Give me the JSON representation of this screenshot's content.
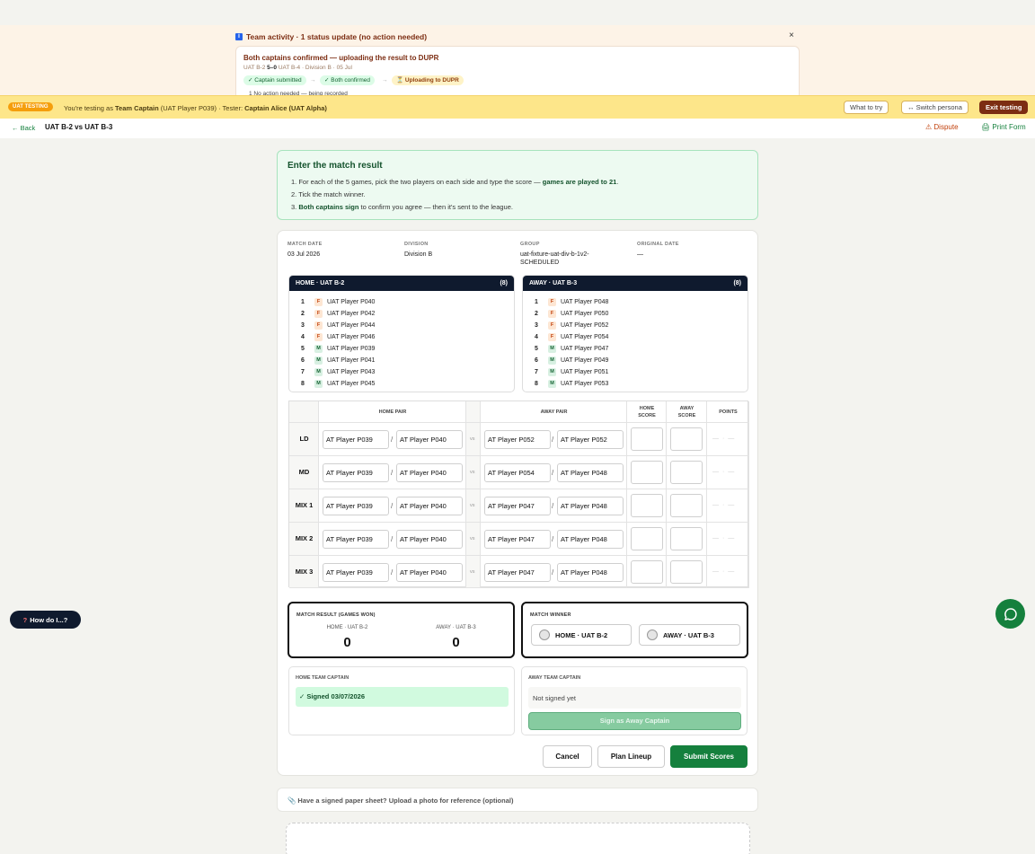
{
  "activity": {
    "header": "Team activity · 1 status update (no action needed)",
    "close": "×",
    "card_title": "Both captains confirmed — uploading the result to DUPR",
    "meta_home": "UAT B-2",
    "meta_score": "5–0",
    "meta_rest": "UAT B-4 · Division B · 05 Jul",
    "chips": [
      "✓ Captain submitted",
      "✓ Both confirmed",
      "⏳ Uploading to DUPR"
    ],
    "arrow": "→",
    "note": "1  No action needed — being recorded"
  },
  "uat": {
    "badge": "UAT TESTING",
    "pre": "You're testing as ",
    "role": "Team Captain",
    "player": " (UAT Player P039)",
    "tester_label": " · Tester: ",
    "tester": "Captain Alice (UAT Alpha)",
    "what": "What to try",
    "switch": "↔ Switch persona",
    "exit": "Exit testing"
  },
  "nav": {
    "back": "← Back",
    "title": "UAT B-2 vs UAT B-3",
    "dispute": "⚠ Dispute",
    "print": "🖨 Print Form"
  },
  "instructions": {
    "title": "Enter the match result",
    "s1_pre": "1. For each of the 5 games, pick the two players on each side and type the score — ",
    "s1_bold": "games are played to 21",
    "s1_post": ".",
    "s2": "2. Tick the match winner.",
    "s3_pre": "3. ",
    "s3_bold": "Both captains sign",
    "s3_post": " to confirm you agree — then it's sent to the league."
  },
  "meta": {
    "date_label": "MATCH DATE",
    "date": "03 Jul 2026",
    "division_label": "DIVISION",
    "division": "Division B",
    "group_label": "GROUP",
    "group": "uat-fixture-uat-div-b-1v2-",
    "group_status": "SCHEDULED",
    "orig_label": "ORIGINAL DATE",
    "orig": "—"
  },
  "home": {
    "title": "HOME · UAT B-2",
    "count": "(8)",
    "players": [
      {
        "n": "1",
        "g": "F",
        "name": "UAT Player P040"
      },
      {
        "n": "2",
        "g": "F",
        "name": "UAT Player P042"
      },
      {
        "n": "3",
        "g": "F",
        "name": "UAT Player P044"
      },
      {
        "n": "4",
        "g": "F",
        "name": "UAT Player P046"
      },
      {
        "n": "5",
        "g": "M",
        "name": "UAT Player P039"
      },
      {
        "n": "6",
        "g": "M",
        "name": "UAT Player P041"
      },
      {
        "n": "7",
        "g": "M",
        "name": "UAT Player P043"
      },
      {
        "n": "8",
        "g": "M",
        "name": "UAT Player P045"
      }
    ]
  },
  "away": {
    "title": "AWAY · UAT B-3",
    "count": "(8)",
    "players": [
      {
        "n": "1",
        "g": "F",
        "name": "UAT Player P048"
      },
      {
        "n": "2",
        "g": "F",
        "name": "UAT Player P050"
      },
      {
        "n": "3",
        "g": "F",
        "name": "UAT Player P052"
      },
      {
        "n": "4",
        "g": "F",
        "name": "UAT Player P054"
      },
      {
        "n": "5",
        "g": "M",
        "name": "UAT Player P047"
      },
      {
        "n": "6",
        "g": "M",
        "name": "UAT Player P049"
      },
      {
        "n": "7",
        "g": "M",
        "name": "UAT Player P051"
      },
      {
        "n": "8",
        "g": "M",
        "name": "UAT Player P053"
      }
    ]
  },
  "games": {
    "hdr_home": "HOME PAIR",
    "hdr_away": "AWAY PAIR",
    "hdr_hs1": "HOME",
    "hdr_hs2": "SCORE",
    "hdr_as1": "AWAY",
    "hdr_as2": "SCORE",
    "hdr_pts": "POINTS",
    "slash": "/",
    "vs": "vs",
    "pts": "— · —",
    "rows": [
      {
        "label": "LD",
        "h1": "AT Player P039",
        "h2": "AT Player P040",
        "a1": "AT Player P052",
        "a2": "AT Player P052"
      },
      {
        "label": "MD",
        "h1": "AT Player P039",
        "h2": "AT Player P040",
        "a1": "AT Player P054",
        "a2": "AT Player P048"
      },
      {
        "label": "MIX 1",
        "h1": "AT Player P039",
        "h2": "AT Player P040",
        "a1": "AT Player P047",
        "a2": "AT Player P048"
      },
      {
        "label": "MIX 2",
        "h1": "AT Player P039",
        "h2": "AT Player P040",
        "a1": "AT Player P047",
        "a2": "AT Player P048"
      },
      {
        "label": "MIX 3",
        "h1": "AT Player P039",
        "h2": "AT Player P040",
        "a1": "AT Player P047",
        "a2": "AT Player P048"
      }
    ]
  },
  "result": {
    "label": "MATCH RESULT (GAMES WON)",
    "home": "HOME · UAT B-2",
    "away": "AWAY · UAT B-3",
    "home_score": "0",
    "away_score": "0"
  },
  "winner": {
    "label": "MATCH WINNER",
    "home": "HOME · UAT B-2",
    "away": "AWAY · UAT B-3"
  },
  "captains": {
    "home_label": "HOME TEAM CAPTAIN",
    "home_status": "✓ Signed 03/07/2026",
    "away_label": "AWAY TEAM CAPTAIN",
    "away_status": "Not signed yet",
    "sign_btn": "Sign as Away Captain"
  },
  "actions": {
    "cancel": "Cancel",
    "plan": "Plan Lineup",
    "submit": "Submit Scores"
  },
  "upload": {
    "text": "📎 Have a signed paper sheet? Upload a photo for reference (optional)"
  },
  "help": {
    "q": "?",
    "label": "How do I...?"
  },
  "colors": {
    "accent": "#15803d",
    "navy": "#0f1a2e",
    "uat_bar": "#fde68a",
    "exit": "#7c2d12"
  }
}
